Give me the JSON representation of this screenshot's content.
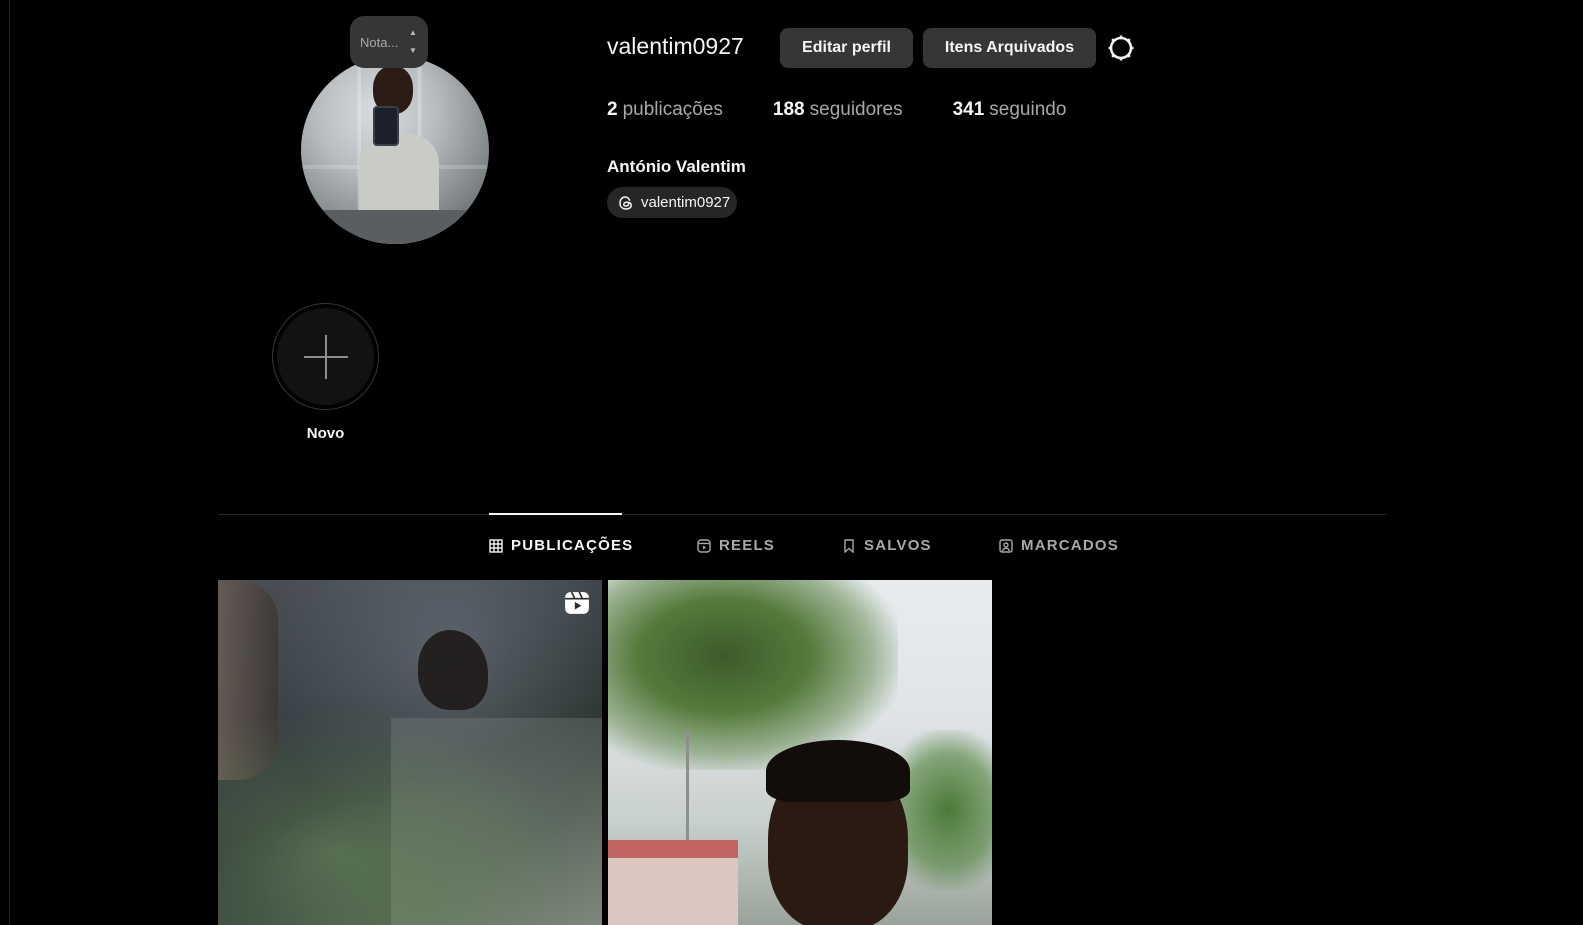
{
  "profile": {
    "username": "valentim0927",
    "full_name": "António Valentim",
    "threads_handle": "valentim0927",
    "note_placeholder": "Nota..."
  },
  "actions": {
    "edit_profile": "Editar perfil",
    "archived_items": "Itens Arquivados"
  },
  "stats": [
    {
      "count": "2",
      "label": "publicações"
    },
    {
      "count": "188",
      "label": "seguidores"
    },
    {
      "count": "341",
      "label": "seguindo"
    }
  ],
  "highlights": {
    "new_label": "Novo"
  },
  "tabs": [
    {
      "label": "PUBLICAÇÕES",
      "icon": "grid-icon",
      "active": true
    },
    {
      "label": "REELS",
      "icon": "reels-icon",
      "active": false
    },
    {
      "label": "SALVOS",
      "icon": "bookmark-icon",
      "active": false
    },
    {
      "label": "MARCADOS",
      "icon": "tagged-icon",
      "active": false
    }
  ],
  "posts": [
    {
      "type": "reel",
      "icon": "reel-badge-icon"
    },
    {
      "type": "photo"
    }
  ],
  "colors": {
    "background": "#000000",
    "button_bg": "#363636",
    "muted_text": "#a8a8a8",
    "text": "#f5f5f5"
  }
}
